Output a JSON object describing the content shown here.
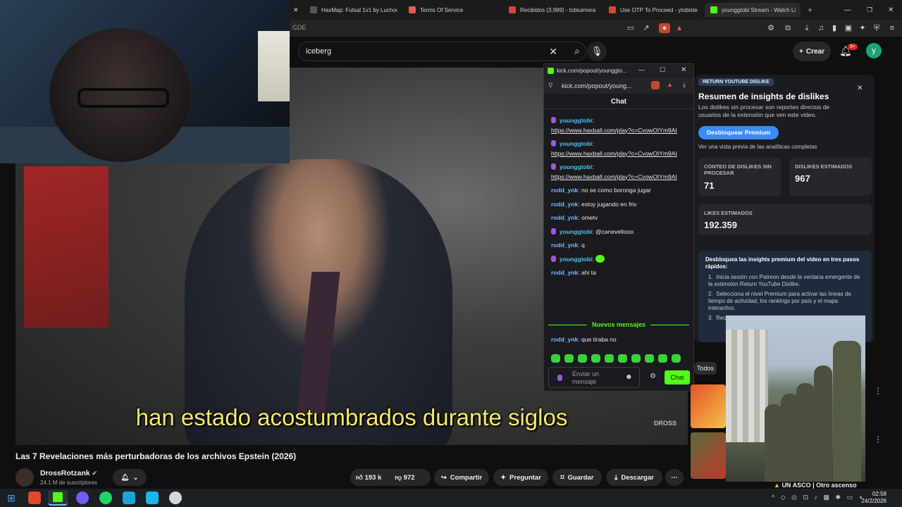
{
  "browser": {
    "tabs": [
      {
        "label": "HaxMap: Futsal 1v1 by Luchoo",
        "icon": "haxmap-favicon",
        "color": "#555555"
      },
      {
        "label": "Terms Of Service",
        "icon": "doc-favicon",
        "color": "#e05a5a"
      },
      {
        "label": "Recibidos (3,999) - tobiuimera",
        "icon": "gmail-favicon",
        "color": "#d44638"
      },
      {
        "label": "Use OTP To Proceed - ytobiste",
        "icon": "gmail-favicon",
        "color": "#d44638"
      },
      {
        "label": "younggtobi Stream - Watch Li",
        "icon": "kick-favicon",
        "color": "#53fc18"
      }
    ],
    "address_fragment": "GDE"
  },
  "youtube": {
    "search_query": "iceberg",
    "create_label": "Crear",
    "notifications_badge": "9+",
    "avatar_letter": "y",
    "subtitle": "han estado acostumbrados durante siglos",
    "watermark": "DROSS",
    "video_title": "Las 7 Revelaciones más perturbadoras de los archivos Epstein (2026)",
    "channel_name": "DrossRotzank",
    "subscribers": "24.1 M de suscriptores",
    "likes": "193 k",
    "dislikes": "972",
    "share_label": "Compartir",
    "ask_label": "Preguntar",
    "save_label": "Guardar",
    "download_label": "Descargar",
    "filter_all": "Todos",
    "ticker": "UN ASCO | Otro ascenso"
  },
  "kick": {
    "window_title": "kick.com/popout/younggto...",
    "url": "kick.com/popout/young...",
    "chat_title": "Chat",
    "messages": [
      {
        "user": "younggtobi",
        "text": "https://www.haxball.com/play?c=CvowOIYm9AI"
      },
      {
        "user": "younggtobi",
        "text": "https://www.haxball.com/play?c=CvowOIYm9AI"
      },
      {
        "user": "younggtobi",
        "text": "https://www.haxball.com/play?c=CvowOIYm9AI"
      },
      {
        "user": "rodd_ynk",
        "text": "no se como boronga jugar"
      },
      {
        "user": "rodd_ynk",
        "text": "estoy jugando en friv"
      },
      {
        "user": "rodd_ynk",
        "text": "ometv"
      },
      {
        "user": "younggtobi",
        "text": "@canevellooo"
      },
      {
        "user": "rodd_ynk",
        "text": "q"
      },
      {
        "user": "younggtobi",
        "text": ""
      },
      {
        "user": "rodd_ynk",
        "text": "ahi ta"
      }
    ],
    "new_messages_label": "Nuevos mensajes",
    "after_new": {
      "user": "rodd_ynk",
      "text": "que tiraba no"
    },
    "input_placeholder": "Enviar un mensaje",
    "send_label": "Chat",
    "accent": "#53fc18"
  },
  "ryd": {
    "badge": "RETURN YOUTUBE DISLIKE",
    "title": "Resumen de insights de dislikes",
    "desc": "Los dislikes sin procesar son reportes directos de usuarios de la extensión que ven este video.",
    "unlock_label": "Desbloquear Premium",
    "preview_text": "Ver una vista previa de las analíticas completas",
    "raw_label": "CONTEO DE DISLIKES SIN PROCESAR",
    "raw_value": "71",
    "est_dislikes_label": "DISLIKES ESTIMADOS",
    "est_dislikes_value": "967",
    "est_likes_label": "LIKES ESTIMADOS",
    "est_likes_value": "192.359",
    "steps_title": "Desbloquea las insights premium del video en tres pasos rápidos:",
    "step1": "Inicia sesión con Patreon desde la ventana emergente de la extensión Return YouTube Dislike.",
    "step2": "Selecciona el nivel Premium para activar las líneas de tiempo de actividad, los rankings por país y el mapa interactivo.",
    "step3": "Rec... país... UU.",
    "accent": "#3d8af7"
  },
  "taskbar": {
    "time": "02:58",
    "date": "24/2/2026"
  }
}
